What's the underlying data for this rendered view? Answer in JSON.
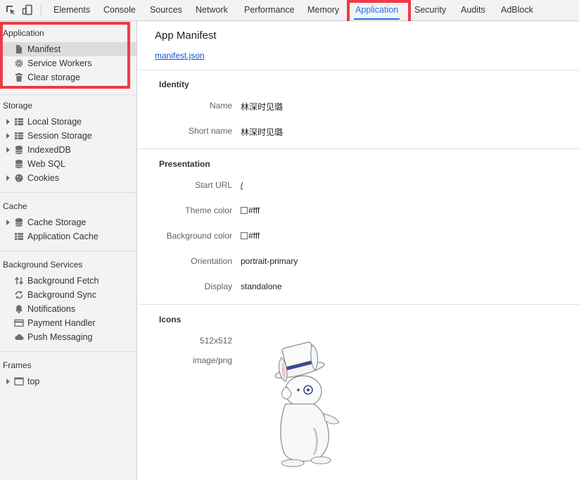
{
  "toolbar": {
    "tabs": [
      "Elements",
      "Console",
      "Sources",
      "Network",
      "Performance",
      "Memory",
      "Application",
      "Security",
      "Audits",
      "AdBlock"
    ],
    "active_tab": "Application",
    "accent_color": "#1a73e8",
    "highlight_color": "#f03a47"
  },
  "sidebar": {
    "application": {
      "title": "Application",
      "items": [
        {
          "label": "Manifest",
          "icon": "document-icon"
        },
        {
          "label": "Service Workers",
          "icon": "gear-icon"
        },
        {
          "label": "Clear storage",
          "icon": "trash-icon"
        }
      ]
    },
    "storage": {
      "title": "Storage",
      "items": [
        {
          "label": "Local Storage",
          "icon": "grid-icon"
        },
        {
          "label": "Session Storage",
          "icon": "grid-icon"
        },
        {
          "label": "IndexedDB",
          "icon": "database-icon"
        },
        {
          "label": "Web SQL",
          "icon": "database-icon"
        },
        {
          "label": "Cookies",
          "icon": "cookie-icon"
        }
      ]
    },
    "cache": {
      "title": "Cache",
      "items": [
        {
          "label": "Cache Storage",
          "icon": "database-icon"
        },
        {
          "label": "Application Cache",
          "icon": "grid-icon"
        }
      ]
    },
    "background": {
      "title": "Background Services",
      "items": [
        {
          "label": "Background Fetch",
          "icon": "up-down-arrows-icon"
        },
        {
          "label": "Background Sync",
          "icon": "sync-icon"
        },
        {
          "label": "Notifications",
          "icon": "bell-icon"
        },
        {
          "label": "Payment Handler",
          "icon": "card-icon"
        },
        {
          "label": "Push Messaging",
          "icon": "cloud-icon"
        }
      ]
    },
    "frames": {
      "title": "Frames",
      "items": [
        {
          "label": "top",
          "icon": "frame-icon"
        }
      ]
    }
  },
  "main": {
    "title": "App Manifest",
    "manifest_link": "manifest.json",
    "identity": {
      "heading": "Identity",
      "name_label": "Name",
      "name_value": "林深时见璐",
      "short_name_label": "Short name",
      "short_name_value": "林深时见璐"
    },
    "presentation": {
      "heading": "Presentation",
      "start_url_label": "Start URL",
      "start_url_value": "/",
      "theme_color_label": "Theme color",
      "theme_color_value": "#fff",
      "background_color_label": "Background color",
      "background_color_value": "#fff",
      "orientation_label": "Orientation",
      "orientation_value": "portrait-primary",
      "display_label": "Display",
      "display_value": "standalone"
    },
    "icons": {
      "heading": "Icons",
      "size": "512x512",
      "type": "image/png"
    }
  }
}
